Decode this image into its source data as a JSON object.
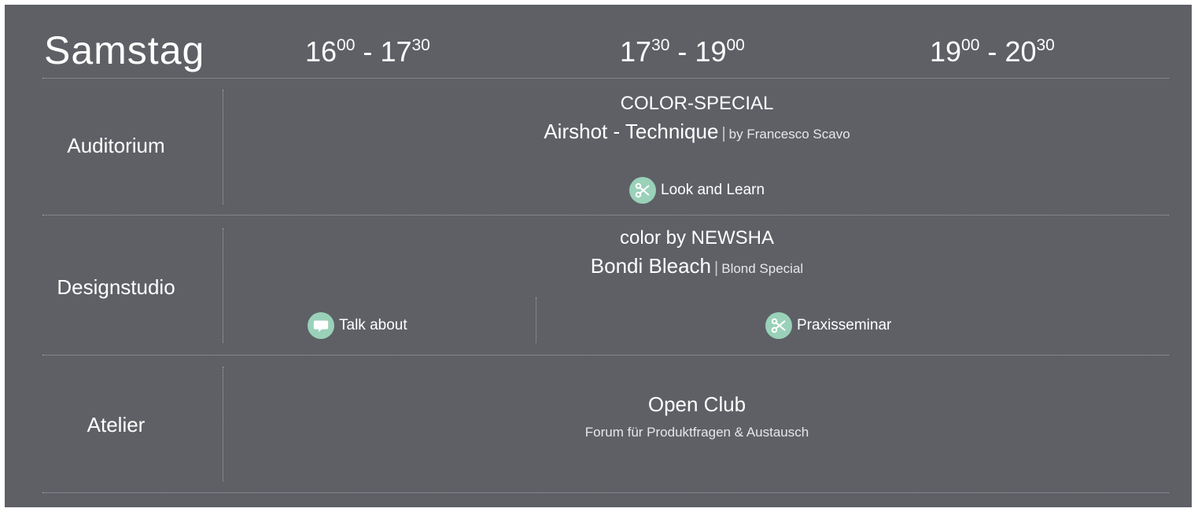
{
  "header": {
    "day": "Samstag",
    "slots": [
      {
        "start_h": "16",
        "start_m": "00",
        "sep": "-",
        "end_h": "17",
        "end_m": "30"
      },
      {
        "start_h": "17",
        "start_m": "30",
        "sep": "-",
        "end_h": "19",
        "end_m": "00"
      },
      {
        "start_h": "19",
        "start_m": "00",
        "sep": "-",
        "end_h": "20",
        "end_m": "30"
      }
    ]
  },
  "rows": [
    {
      "room": "Auditorium",
      "category": "COLOR-SPECIAL",
      "title": "Airshot - Technique",
      "separator": "|",
      "subtitle": "by Francesco Scavo",
      "tags": [
        {
          "icon": "scissors-icon",
          "label": "Look and Learn"
        }
      ]
    },
    {
      "room": "Designstudio",
      "category": "color by NEWSHA",
      "title": "Bondi Bleach",
      "separator": "|",
      "subtitle": "Blond Special",
      "tags": [
        {
          "icon": "speech-bubble-icon",
          "label": "Talk about"
        },
        {
          "icon": "scissors-icon",
          "label": "Praxisseminar"
        }
      ]
    },
    {
      "room": "Atelier",
      "title": "Open Club",
      "subtitle": "Forum für Produktfragen & Austausch"
    }
  ],
  "colors": {
    "panel": "#5e6066",
    "badge": "#9ad1b9",
    "text": "#ffffff"
  }
}
